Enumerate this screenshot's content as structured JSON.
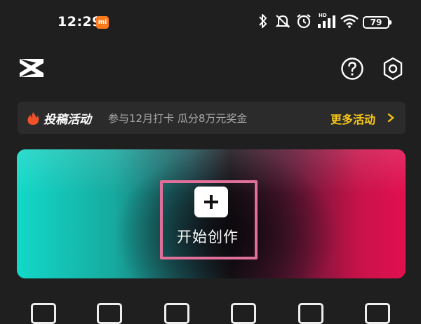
{
  "status_bar": {
    "time": "12:29",
    "notification_badge": "mi",
    "network_label": "HD",
    "battery": "79",
    "icons": [
      "bluetooth-icon",
      "mute-icon",
      "alarm-icon",
      "signal-icon",
      "wifi-icon",
      "battery-icon"
    ]
  },
  "top_bar": {
    "logo": "capcut-logo-icon",
    "help_icon": "help-icon",
    "settings_icon": "settings-icon"
  },
  "banner": {
    "title": "投稿活动",
    "description": "参与12月打卡 瓜分8万元奖金",
    "more_label": "更多活动",
    "title_color": "#ffffff",
    "more_color": "#f5c518"
  },
  "create": {
    "label": "开始创作",
    "highlight_color": "#e0709a"
  },
  "tools": {
    "icons": [
      "play-video-icon",
      "clips-icon",
      "image-icon",
      "camera-icon",
      "document-icon",
      "template-icon"
    ]
  }
}
